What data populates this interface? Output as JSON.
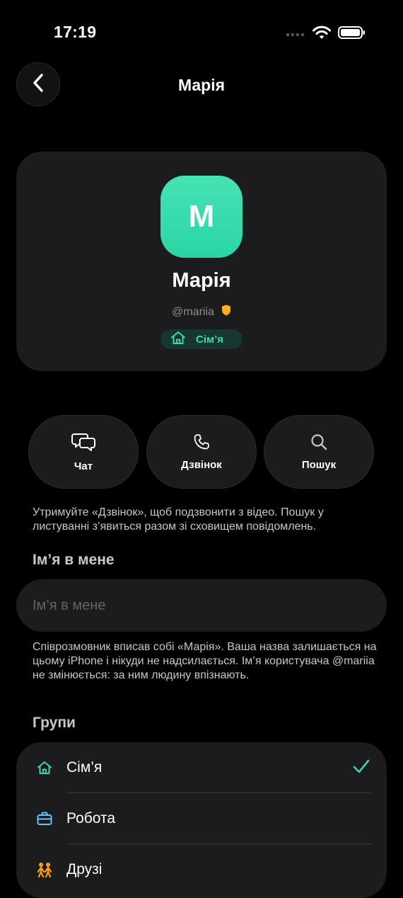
{
  "status_bar": {
    "time": "17:19"
  },
  "nav": {
    "title": "Марія"
  },
  "profile": {
    "avatar_letter": "M",
    "name": "Марія",
    "handle": "@mariia",
    "group_chip": "Сім’я"
  },
  "actions": [
    {
      "label": "Чат",
      "icon": "chat-icon"
    },
    {
      "label": "Дзвінок",
      "icon": "phone-icon"
    },
    {
      "label": "Пошук",
      "icon": "search-icon"
    }
  ],
  "action_hint": "Утримуйте «Дзвінок», щоб подзвонити з відео. Пошук у листуванні з’явиться разом зі сховищем повідомлень.",
  "nickname": {
    "section_title": "Ім’я в мене",
    "placeholder": "Ім’я в мене",
    "value": "",
    "hint": "Співрозмовник вписав собі «Марія». Ваша назва залишається на цьому iPhone і нікуди не надсилається. Ім’я користувача @mariia не змінюється: за ним людину впізнають."
  },
  "groups": {
    "section_title": "Групи",
    "items": [
      {
        "label": "Сім’я",
        "icon": "home-icon",
        "selected": true
      },
      {
        "label": "Робота",
        "icon": "briefcase-icon",
        "selected": false
      },
      {
        "label": "Друзі",
        "icon": "people-icon",
        "selected": false
      }
    ]
  },
  "colors": {
    "accent_green": "#3fd6ae",
    "work_blue": "#5ac8fa",
    "friends_orange": "#ff9f0a",
    "verified_badge": "#ffb020",
    "card_bg": "#1c1c1e"
  }
}
